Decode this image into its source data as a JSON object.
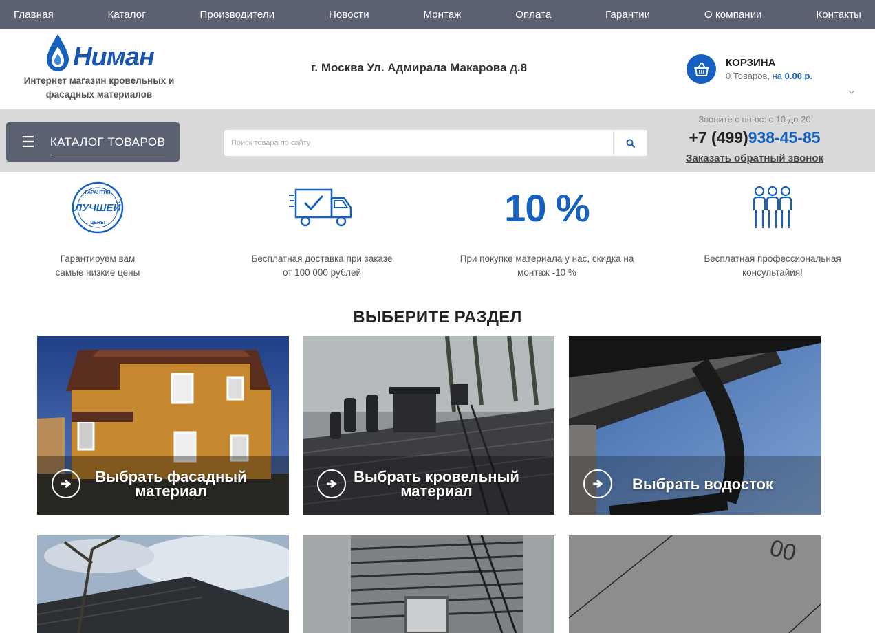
{
  "nav": [
    "Главная",
    "Каталог",
    "Производители",
    "Новости",
    "Монтаж",
    "Оплата",
    "Гарантии",
    "О компании",
    "Контакты"
  ],
  "header": {
    "logo_text": "Ниман",
    "logo_sub_1": "Интернет магазин кровельных и",
    "logo_sub_2": "фасадных материалов",
    "address": "г. Москва Ул. Адмирала Макарова д.8",
    "cart_title": "КОРЗИНА",
    "cart_count": "0 Товаров,",
    "cart_on": "на",
    "cart_sum": "0.00 р."
  },
  "bar": {
    "catalog_label": "КАТАЛОГ ТОВАРОВ",
    "search_placeholder": "Поиск товара по сайту",
    "call_hours": "Звоните с пн-вс: с 10 до 20",
    "phone_code": "+7 (499)",
    "phone_num": "938-45-85",
    "callback": "Заказать обратный звонок"
  },
  "features": [
    {
      "icon": "best-price-badge-icon",
      "line1": "Гарантируем вам",
      "line2": "самые низкие цены",
      "badge_top": "ГАРАНТИЯ",
      "badge_mid": "ЛУЧШЕЙ",
      "badge_bot": "ЦЕНЫ"
    },
    {
      "icon": "delivery-truck-icon",
      "line1": "Бесплатная доставка при заказе",
      "line2": "от 100 000 рублей"
    },
    {
      "icon": "percent",
      "value": "10 %",
      "line1": "При покупке материала у нас, скидка на",
      "line2": "монтаж -10 %"
    },
    {
      "icon": "consultants-icon",
      "line1": "Бесплатная профессиональная",
      "line2": "консультайия!"
    }
  ],
  "section_title": "ВЫБЕРИТЕ РАЗДЕЛ",
  "cards": [
    {
      "line1": "Выбрать фасадный",
      "line2": "материал"
    },
    {
      "line1": "Выбрать кровельный",
      "line2": "материал"
    },
    {
      "line1": "Выбрать водосток",
      "line2": ""
    }
  ],
  "colors": {
    "accent": "#1660bf",
    "nav": "#5b6170",
    "bar": "#d9d9d9"
  }
}
